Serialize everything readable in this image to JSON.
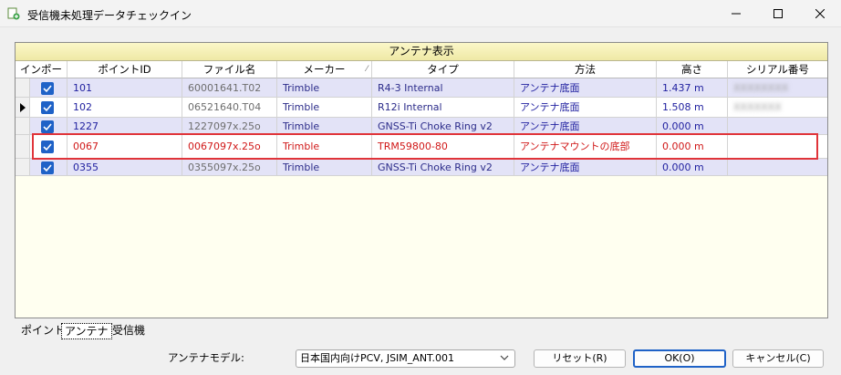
{
  "window": {
    "title": "受信機未処理データチェックイン",
    "icons": {
      "app": "add-document-icon",
      "minimize": "minimize-icon",
      "maximize": "maximize-icon",
      "close": "close-icon"
    }
  },
  "grid": {
    "band_title": "アンテナ表示",
    "columns": [
      "インポート",
      "ポイントID",
      "ファイル名",
      "メーカー",
      "タイプ",
      "方法",
      "高さ",
      "シリアル番号"
    ],
    "rows": [
      {
        "checked": true,
        "point_id": "101",
        "file": "60001641.T02",
        "maker": "Trimble",
        "type": "R4-3 Internal",
        "method": "アンテナ底面",
        "height": "1.437 m",
        "serial": "XXXXXXXX"
      },
      {
        "checked": true,
        "point_id": "102",
        "file": "06521640.T04",
        "maker": "Trimble",
        "type": "R12i Internal",
        "method": "アンテナ底面",
        "height": "1.508 m",
        "serial": "XXXXXXX"
      },
      {
        "checked": true,
        "point_id": "1227",
        "file": "1227097x.25o",
        "maker": "Trimble",
        "type": "GNSS-Ti Choke Ring v2",
        "method": "アンテナ底面",
        "height": "0.000 m",
        "serial": ""
      },
      {
        "checked": true,
        "point_id": "0067",
        "file": "0067097x.25o",
        "maker": "Trimble",
        "type": "TRM59800-80",
        "method": "アンテナマウントの底部",
        "height": "0.000 m",
        "serial": ""
      },
      {
        "checked": true,
        "point_id": "0355",
        "file": "0355097x.25o",
        "maker": "Trimble",
        "type": "GNSS-Ti Choke Ring v2",
        "method": "アンテナ底面",
        "height": "0.000 m",
        "serial": ""
      }
    ]
  },
  "tabs": [
    "ポイント",
    "アンテナ",
    "受信機"
  ],
  "bottom": {
    "model_label": "アンテナモデル:",
    "model_value": "日本国内向けPCV, JSIM_ANT.001",
    "reset_label": "リセット(R)",
    "ok_label": "OK(O)",
    "cancel_label": "キャンセル(C)"
  },
  "colors": {
    "highlight": "#e0343a",
    "accent": "#1f62c7",
    "band": "#f5f0b8"
  }
}
